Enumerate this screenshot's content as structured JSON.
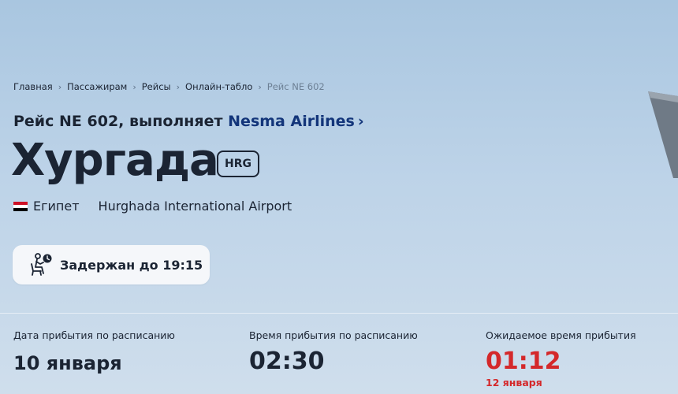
{
  "breadcrumb": [
    "Главная",
    "Пассажирам",
    "Рейсы",
    "Онлайн-табло",
    "Рейс NE 602"
  ],
  "flight": {
    "prefix": "Рейс NE 602, выполняет",
    "airline": "Nesma Airlines",
    "city": "Хургада",
    "iata": "HRG",
    "country": "Египет",
    "airport": "Hurghada International Airport"
  },
  "status": {
    "text": "Задержан до 19:15",
    "icon": "waiting-passenger-clock-icon"
  },
  "details": {
    "scheduled_date_label": "Дата прибытия по расписанию",
    "scheduled_date": "10 января",
    "scheduled_time_label": "Время прибытия по расписанию",
    "scheduled_time": "02:30",
    "expected_time_label": "Ожидаемое время прибытия",
    "expected_time": "01:12",
    "expected_date": "12 января"
  },
  "colors": {
    "accent_link": "#13357a",
    "delay_red": "#d4282a",
    "text_dark": "#1b2433"
  }
}
